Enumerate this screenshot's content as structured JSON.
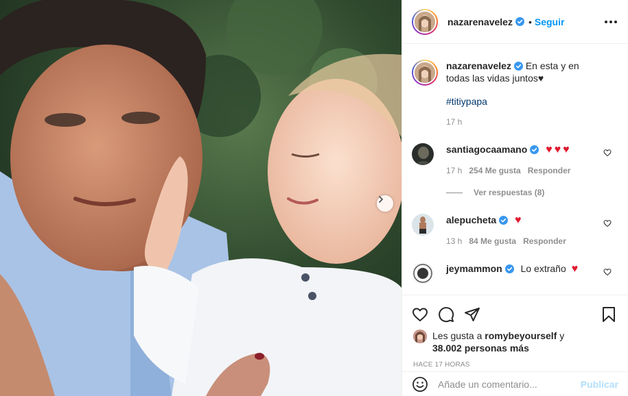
{
  "post": {
    "username": "nazarenavelez",
    "follow_label": "Seguir",
    "dot": "•",
    "caption_text": "En esta y en todas las vidas juntos♥",
    "hashtag": "#titiypapa",
    "caption_time": "17 h"
  },
  "comments": [
    {
      "username": "santiagocaamano",
      "text": "",
      "time": "17 h",
      "likes": "254 Me gusta",
      "reply": "Responder",
      "hearts": 3
    },
    {
      "username": "alepucheta",
      "text": "",
      "time": "13 h",
      "likes": "84 Me gusta",
      "reply": "Responder",
      "hearts": 1
    },
    {
      "username": "jeymammon",
      "text": "Lo extraño",
      "hearts": 1
    }
  ],
  "view_replies": "Ver respuestas (8)",
  "likes": {
    "prefix": "Les gusta a",
    "user": "romybeyourself",
    "connector": "y",
    "others": "38.002 personas más"
  },
  "timestamp": "Hace 17 horas",
  "add_comment": {
    "placeholder": "Añade un comentario...",
    "publish_label": "Publicar"
  },
  "colors": {
    "accent": "#0095f6",
    "heart": "#ed4956",
    "muted": "#8e8e8e"
  },
  "icons": {
    "next": "chevron-right-icon",
    "like": "heart-icon",
    "comment": "comment-icon",
    "share": "paper-plane-icon",
    "save": "bookmark-icon",
    "emoji": "smiley-icon",
    "more": "ellipsis-icon",
    "verified": "verified-badge-icon"
  }
}
